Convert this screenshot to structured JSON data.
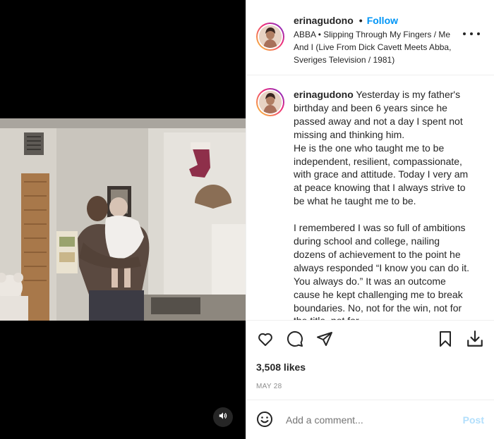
{
  "header": {
    "username": "erinagudono",
    "separator": "•",
    "follow_label": "Follow",
    "audio_credit": "ABBA • Slipping Through My Fingers / Me And I (Live From Dick Cavett Meets Abba, Sveriges Television / 1981)"
  },
  "caption": {
    "username": "erinagudono",
    "text": " Yesterday is my father's birthday and been 6 years since he passed away and not a day I spent not missing and thinking him.\nHe is the one who taught me to be independent, resilient, compassionate, with grace and attitude. Today I very am at peace knowing that I always strive to be what he taught me to be.\n\nI remembered I was so full of ambitions during school and college, nailing dozens of achievement to the point he always responded “I know you can do it. You always do.” It was an outcome cause he kept challenging me to break boundaries. No, not for the win, not for the title, not for"
  },
  "actions": {
    "like_icon": "heart-icon",
    "comment_icon": "comment-icon",
    "share_icon": "share-icon",
    "save_icon": "bookmark-icon",
    "download_icon": "download-icon"
  },
  "likes": "3,508 likes",
  "date": "MAY 28",
  "comment": {
    "emoji_icon": "emoji-icon",
    "placeholder": "Add a comment...",
    "post_label": "Post"
  },
  "media": {
    "audio_icon": "speaker-icon"
  },
  "colors": {
    "accent": "#0095f6",
    "post_disabled": "#b2dffc",
    "muted": "#8e8e8e",
    "border": "#efefef"
  }
}
